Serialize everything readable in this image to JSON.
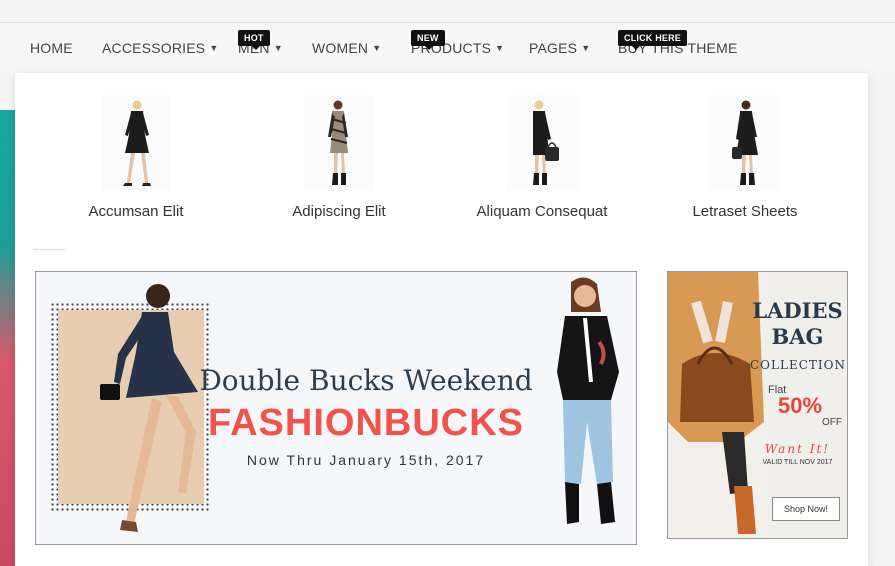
{
  "nav": {
    "items": [
      {
        "label": "HOME",
        "caret": false
      },
      {
        "label": "ACCESSORIES",
        "caret": true
      },
      {
        "label": "MEN",
        "caret": true,
        "badge": "HOT"
      },
      {
        "label": "WOMEN",
        "caret": true
      },
      {
        "label": "PRODUCTS",
        "caret": true,
        "badge": "NEW"
      },
      {
        "label": "PAGES",
        "caret": true
      },
      {
        "label": "BUY THIS THEME",
        "caret": false,
        "badge": "CLICK HERE"
      }
    ],
    "caret_glyph": "▼"
  },
  "products": [
    {
      "name": "Accumsan Elit"
    },
    {
      "name": "Adipiscing Elit"
    },
    {
      "name": "Aliquam Consequat"
    },
    {
      "name": "Letraset Sheets"
    }
  ],
  "promo": {
    "title": "Double Bucks Weekend",
    "headline": "FASHIONBUCKS",
    "subtitle": "Now Thru January 15th, 2017"
  },
  "side_promo": {
    "line1": "LADIES",
    "line2": "BAG",
    "collection": "COLLECTION",
    "flat": "Flat",
    "percent": "50%",
    "off": "OFF",
    "want": "Want It!",
    "valid": "VALID TILL NOV 2017",
    "button": "Shop Now!"
  },
  "colors": {
    "accent": "#f2524a",
    "badge": "#111111",
    "nav_text": "#444444"
  }
}
